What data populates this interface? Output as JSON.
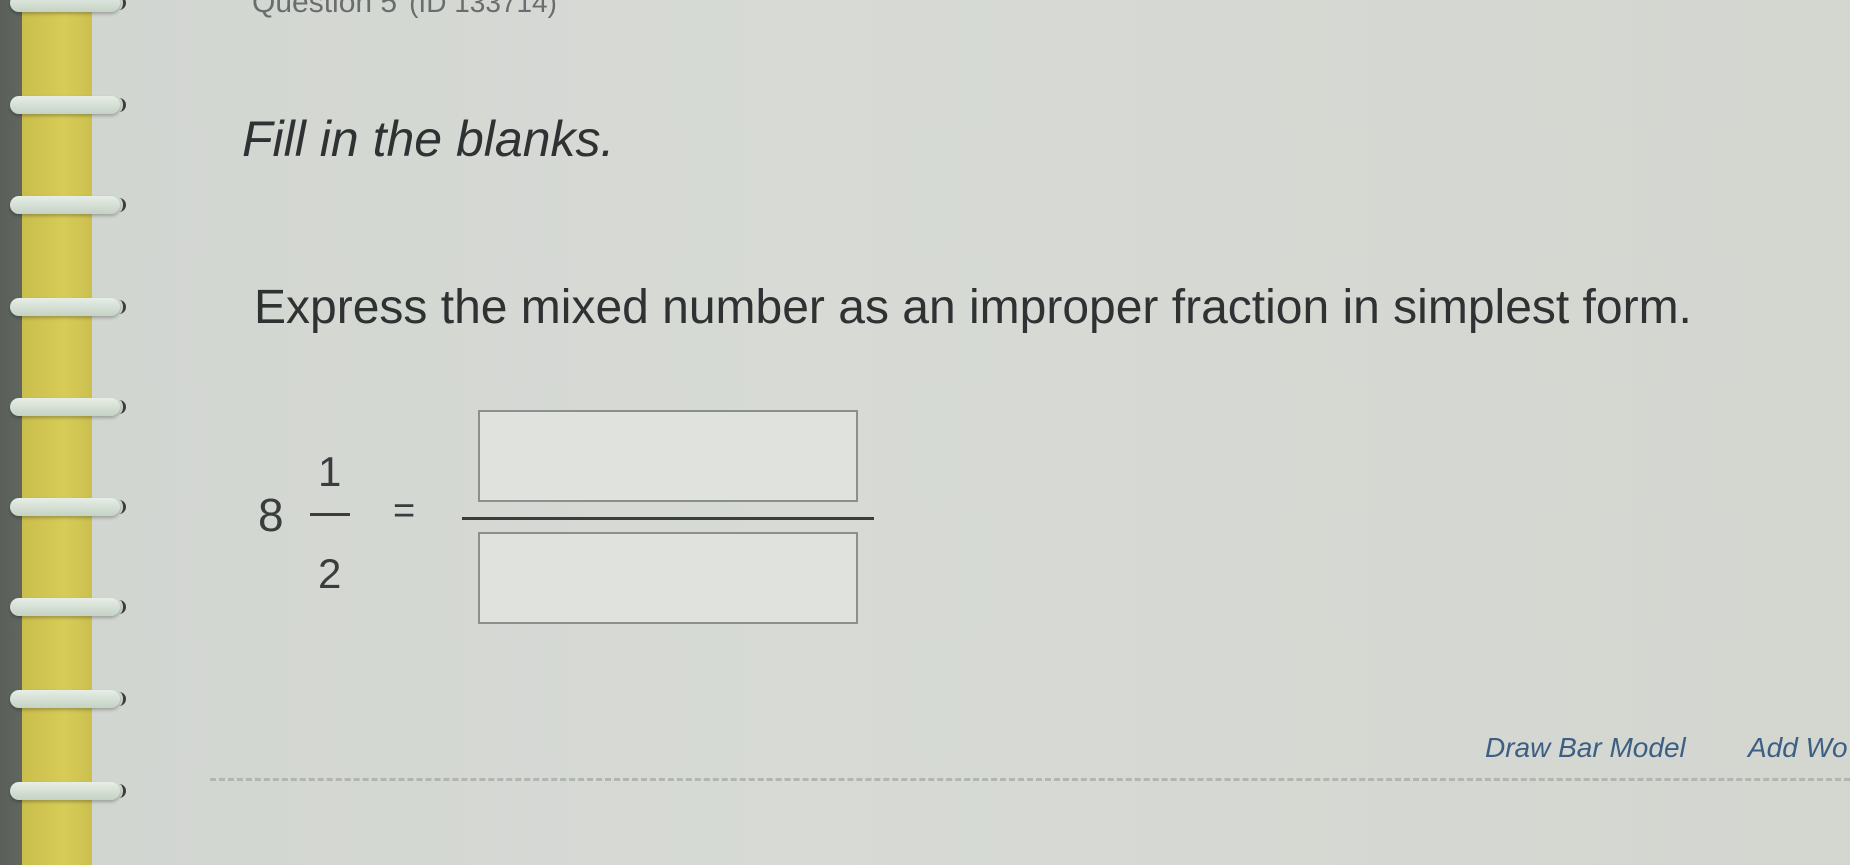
{
  "question": {
    "header": "Question 5",
    "id_label": "(ID 133714)"
  },
  "instruction": "Fill in the blanks.",
  "prompt": "Express the mixed number as an improper fraction in simplest form.",
  "mixed_number": {
    "whole": "8",
    "numerator": "1",
    "denominator": "2"
  },
  "equals": "=",
  "answer": {
    "numerator_value": "",
    "denominator_value": ""
  },
  "tools": {
    "draw_bar_model": "Draw Bar Model",
    "add_work": "Add Wo"
  },
  "colors": {
    "rail": "#d8cc58",
    "link": "#3d5f83",
    "sheet": "#d5d8d3"
  }
}
